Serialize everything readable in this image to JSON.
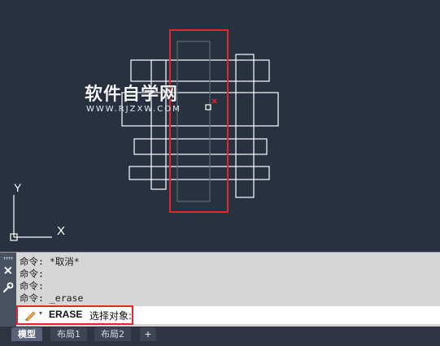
{
  "watermark": {
    "title": "软件自学网",
    "url": "WWW.RJZXW.COM"
  },
  "ucs": {
    "y_label": "Y",
    "x_label": "X"
  },
  "command_history": [
    "命令: *取消*",
    "命令:",
    "命令:",
    "命令: _erase"
  ],
  "command_line": {
    "command": "ERASE",
    "prompt": "选择对象:"
  },
  "tabs": [
    {
      "label": "模型",
      "active": true
    },
    {
      "label": "布局1",
      "active": false
    },
    {
      "label": "布局2",
      "active": false
    }
  ],
  "colors": {
    "highlight": "#e3262b",
    "canvas": "#283140",
    "lines": "#ffffff"
  }
}
